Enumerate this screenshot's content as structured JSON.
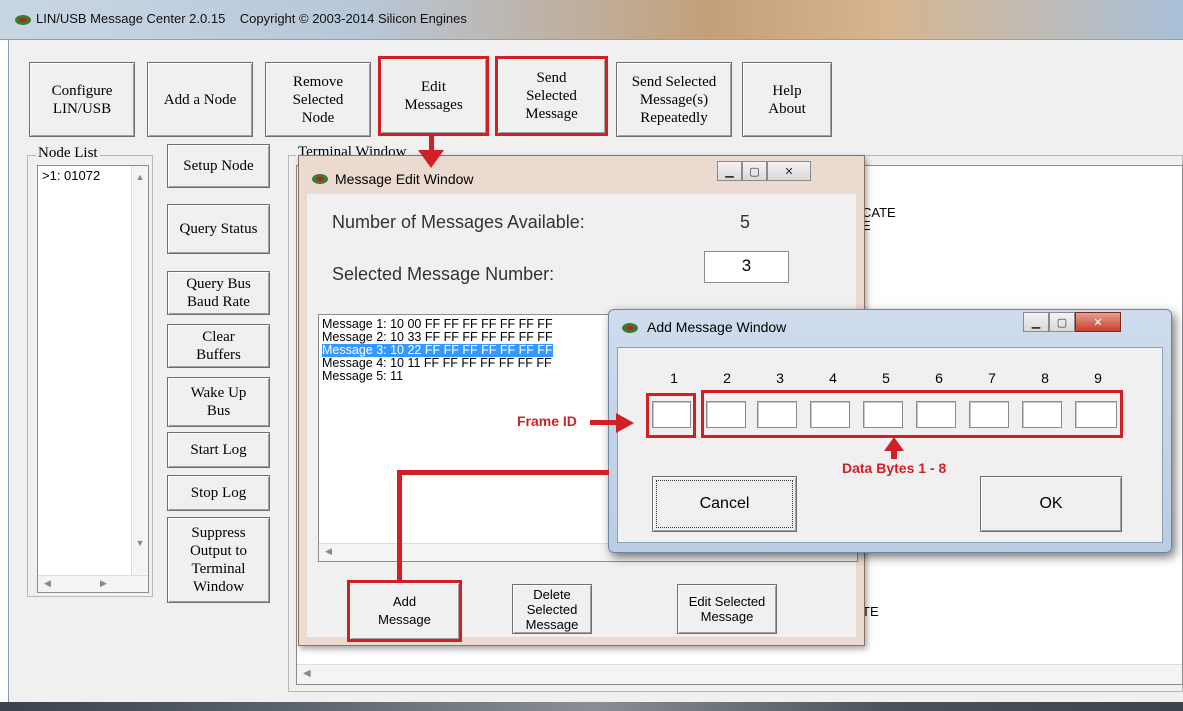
{
  "window": {
    "title": "LIN/USB Message Center 2.0.15    Copyright © 2003-2014 Silicon Engines"
  },
  "toolbar": {
    "configure": "Configure\nLIN/USB",
    "add_node": "Add a Node",
    "remove_node": "Remove\nSelected\nNode",
    "edit_messages": "Edit\nMessages",
    "send_selected": "Send\nSelected\nMessage",
    "send_repeated": "Send Selected\nMessage(s)\nRepeatedly",
    "help": "Help\nAbout"
  },
  "node_list": {
    "label": "Node List",
    "items": [
      ">1: 01072"
    ]
  },
  "side_buttons": {
    "setup_node": "Setup Node",
    "query_status": "Query Status",
    "query_baud": "Query Bus\nBaud Rate",
    "clear_buffers": "Clear\nBuffers",
    "wake_up": "Wake Up\nBus",
    "start_log": "Start Log",
    "stop_log": "Stop Log",
    "suppress": "Suppress\nOutput to\nTerminal\nWindow"
  },
  "terminal": {
    "label": "Terminal Window",
    "fragments": [
      "CATE",
      "E",
      "TE"
    ]
  },
  "message_edit": {
    "title": "Message Edit Window",
    "num_available_label": "Number of Messages Available:",
    "num_available": "5",
    "selected_label": "Selected Message Number:",
    "selected_value": "3",
    "messages": [
      "Message 1: 10 00 FF FF FF FF FF FF FF",
      "Message 2: 10 33 FF FF FF FF FF FF FF",
      "Message 3: 10 22 FF FF FF FF FF FF FF",
      "Message 4: 10 11 FF FF FF FF FF FF FF",
      "Message 5: 11"
    ],
    "selected_index": 2,
    "add_button": "Add\nMessage",
    "delete_button": "Delete\nSelected\nMessage",
    "edit_button": "Edit Selected\nMessage"
  },
  "add_message": {
    "title": "Add Message Window",
    "columns": [
      "1",
      "2",
      "3",
      "4",
      "5",
      "6",
      "7",
      "8",
      "9"
    ],
    "cancel": "Cancel",
    "ok": "OK"
  },
  "annotations": {
    "frame_id": "Frame ID",
    "data_bytes": "Data Bytes 1 - 8"
  },
  "colors": {
    "highlight": "#d21f26",
    "selection": "#3399ff"
  }
}
